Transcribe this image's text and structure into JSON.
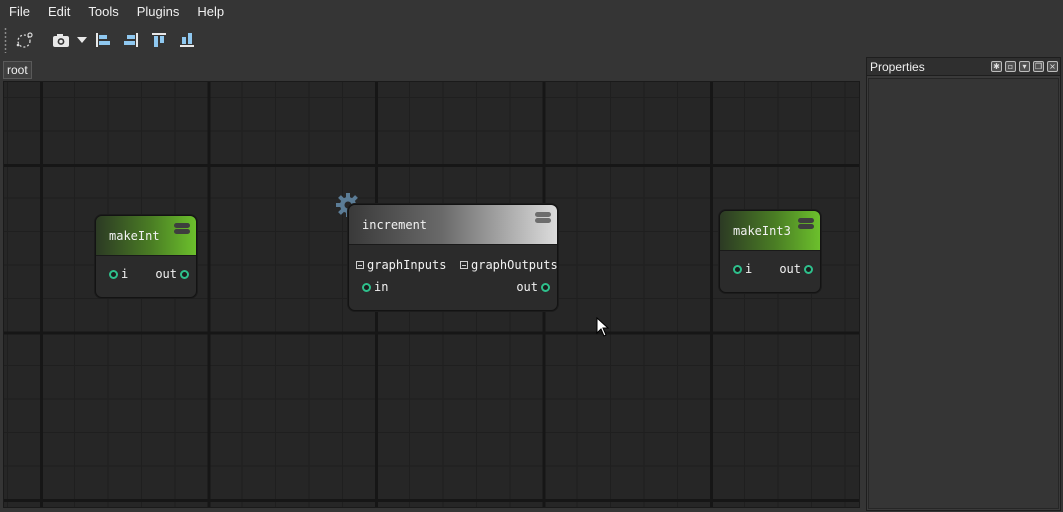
{
  "menu": [
    "File",
    "Edit",
    "Tools",
    "Plugins",
    "Help"
  ],
  "toolbar": {
    "icons": [
      "layout-icon",
      "camera-icon",
      "dropdown-arrow-icon",
      "align-left-icon",
      "align-right-icon",
      "align-top-icon",
      "align-bottom-icon"
    ]
  },
  "breadcrumb": "root",
  "nodes": {
    "makeInt": {
      "title": "makeInt",
      "in": "i",
      "out": "out"
    },
    "increment": {
      "title": "increment",
      "group_in": "graphInputs",
      "group_out": "graphOutputs",
      "in": "in",
      "out": "out"
    },
    "makeInt3": {
      "title": "makeInt3",
      "in": "i",
      "out": "out"
    }
  },
  "properties": {
    "title": "Properties"
  },
  "colors": {
    "port": "#2ec08c",
    "node_green": "#6cc02c",
    "background": "#262626"
  }
}
